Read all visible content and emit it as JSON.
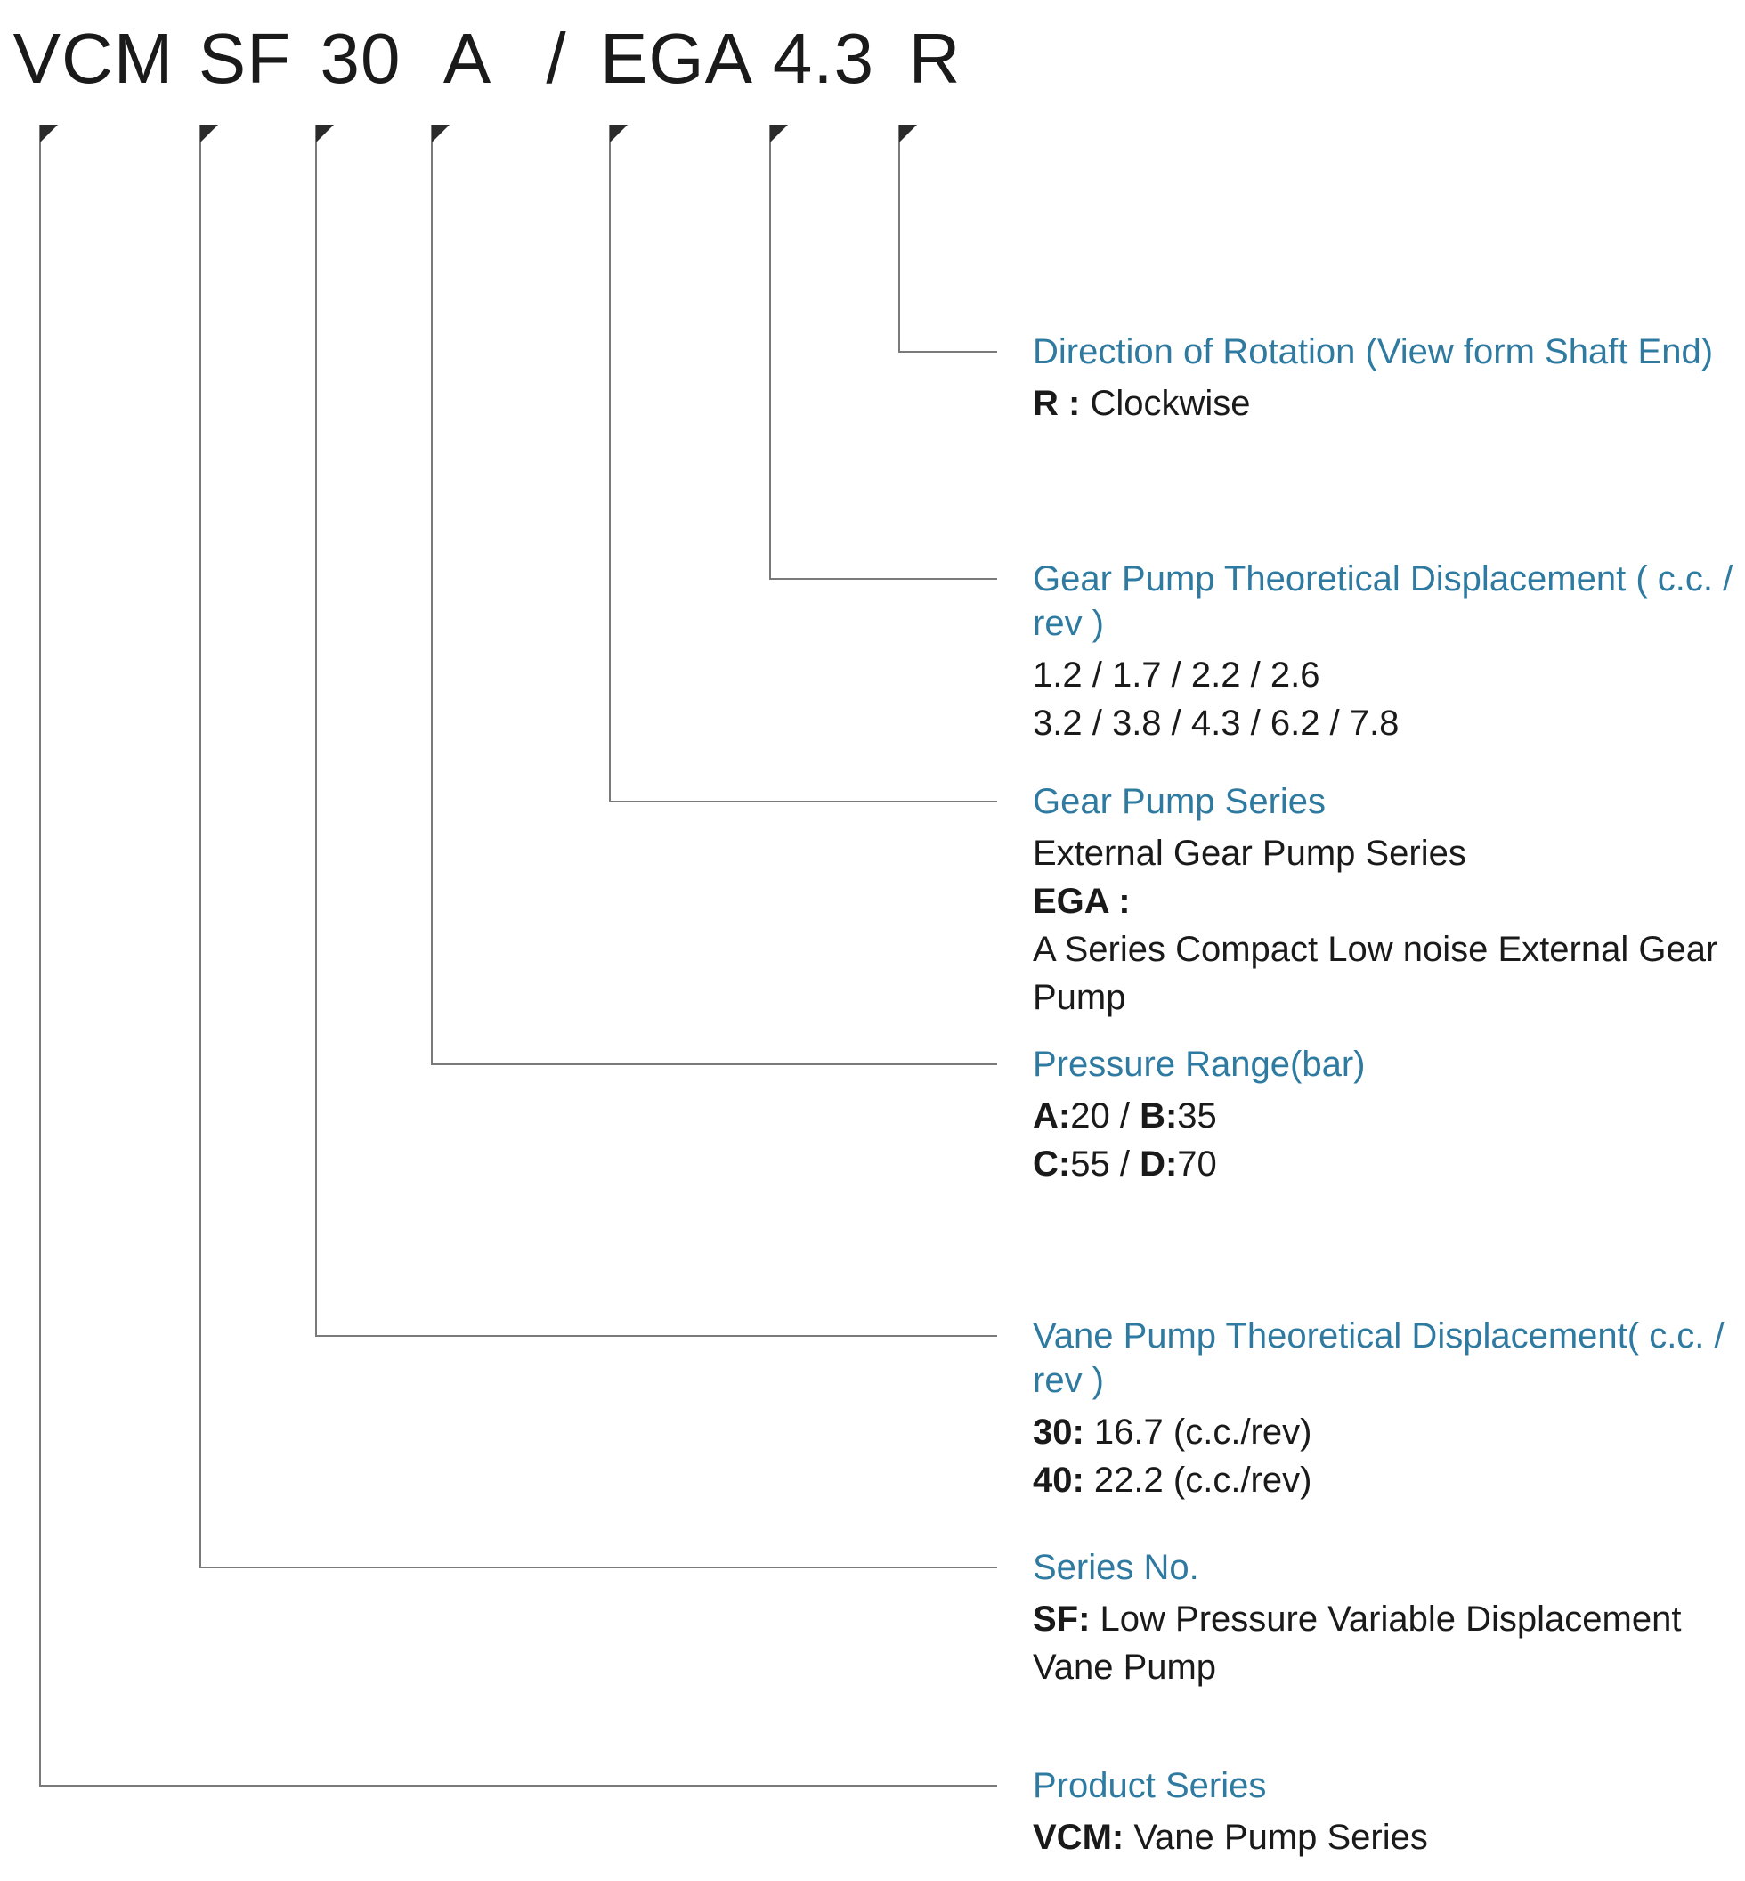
{
  "code": {
    "seg1": "VCM",
    "seg2": "SF",
    "seg3": "30",
    "seg4": "A",
    "sep": "/",
    "seg5": "EGA",
    "seg6": "4.3",
    "seg7": "R"
  },
  "d_rotation": {
    "title": "Direction of Rotation (View form Shaft End)",
    "k1": "R :",
    "v1": " Clockwise"
  },
  "d_geardisp": {
    "title": "Gear Pump Theoretical Displacement ( c.c. / rev )",
    "l1": "1.2 / 1.7 / 2.2 / 2.6",
    "l2": "3.2 / 3.8 / 4.3 / 6.2 / 7.8"
  },
  "d_gearseries": {
    "title": "Gear Pump Series",
    "l1": "External Gear Pump Series",
    "k2": "EGA :",
    "l3": "A Series Compact Low noise External Gear Pump"
  },
  "d_pressure": {
    "title": "Pressure Range(bar)",
    "k1": "A:",
    "v1": "20 / ",
    "k2": "B:",
    "v2": "35",
    "k3": "C:",
    "v3": "55 / ",
    "k4": "D:",
    "v4": "70"
  },
  "d_vanedisp": {
    "title": "Vane Pump Theoretical Displacement( c.c. / rev )",
    "k1": "30:",
    "v1": " 16.7 (c.c./rev)",
    "k2": "40:",
    "v2": " 22.2 (c.c./rev)"
  },
  "d_seriesno": {
    "title": "Series No.",
    "k1": "SF:",
    "v1": " Low Pressure Variable Displacement Vane Pump"
  },
  "d_product": {
    "title": "Product Series",
    "k1": "VCM:",
    "v1": " Vane Pump Series"
  }
}
